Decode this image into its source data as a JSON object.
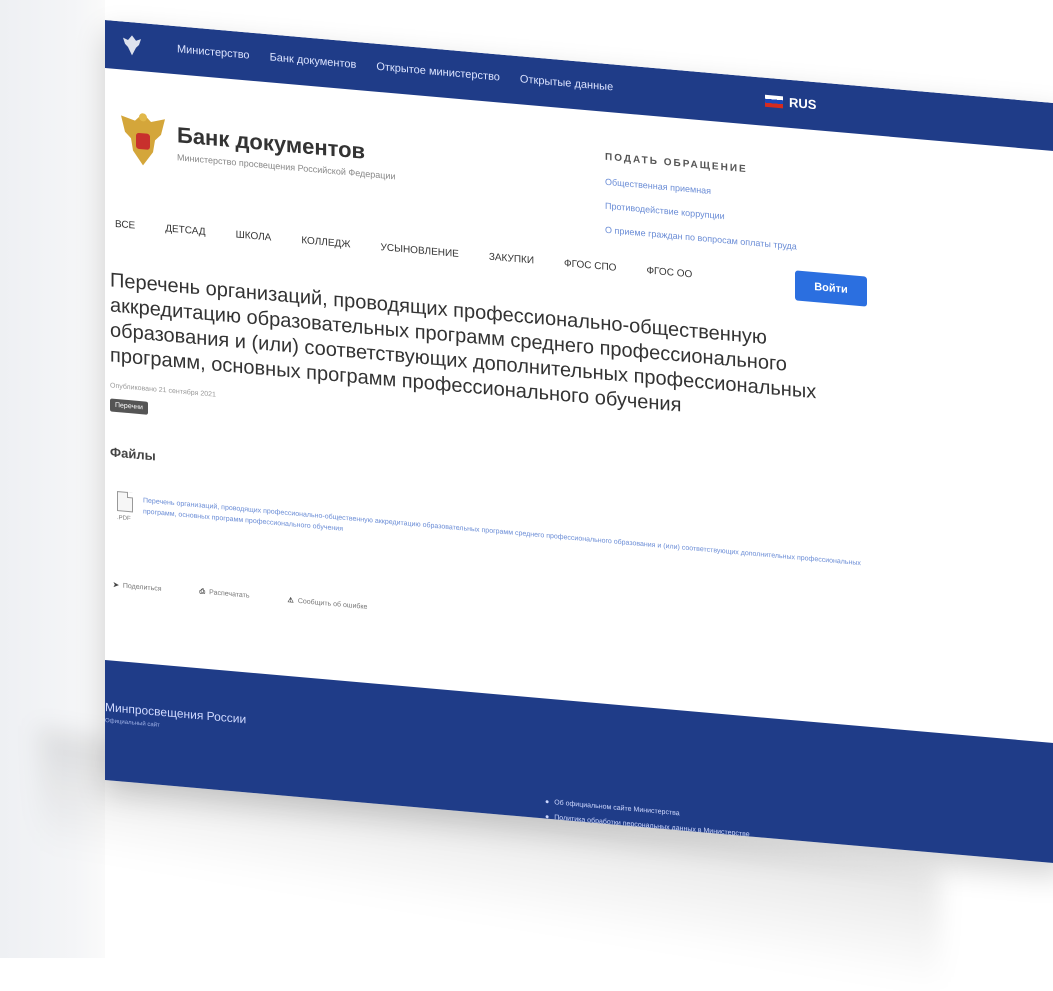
{
  "topbar": {
    "nav": [
      "Министерство",
      "Банк документов",
      "Открытое министерство",
      "Открытые данные"
    ],
    "language": "RUS"
  },
  "header": {
    "title": "Банк документов",
    "subtitle": "Министерство просвещения Российской Федерации",
    "appeal": {
      "title": "ПОДАТЬ ОБРАЩЕНИЕ",
      "links": [
        "Общественная приемная",
        "Противодействие коррупции",
        "О приеме граждан по вопросам оплаты труда"
      ]
    }
  },
  "categories": [
    "ВСЕ",
    "ДЕТСАД",
    "ШКОЛА",
    "КОЛЛЕДЖ",
    "УСЫНОВЛЕНИЕ",
    "ЗАКУПКИ",
    "ФГОС СПО",
    "ФГОС ОО"
  ],
  "login_label": "Войти",
  "document": {
    "title": "Перечень организаций, проводящих профессионально-общественную аккредитацию образовательных программ среднего профессионального образования и (или) соответствующих дополнительных профессиональных программ, основных программ профессионального обучения",
    "date": "Опубликовано 21 сентября 2021",
    "tag": "Перечни"
  },
  "files": {
    "heading": "Файлы",
    "items": [
      {
        "type": ".PDF",
        "name": "Перечень организаций, проводящих профессионально-общественную аккредитацию образовательных программ среднего профессионального образования и (или) соответствующих дополнительных профессиональных программ, основных программ профессионального обучения"
      }
    ]
  },
  "share": [
    "Поделиться",
    "Распечатать",
    "Сообщить об ошибке"
  ],
  "footer": {
    "title": "Минпросвещения России",
    "subtitle": "Официальный сайт",
    "links": [
      "Об официальном сайте Министерства",
      "Политика обработки персональных данных в Министерстве"
    ]
  },
  "colors": {
    "primary": "#1f3c88",
    "button": "#2b6fe0",
    "link": "#6b8dd6"
  }
}
